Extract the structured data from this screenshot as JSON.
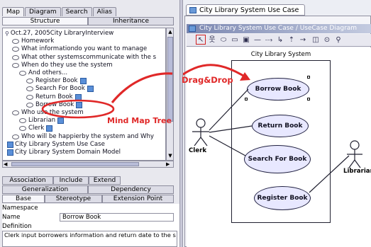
{
  "left_tabs": [
    "Map",
    "Diagram",
    "Search",
    "Alias"
  ],
  "left_subtabs": [
    "Structure",
    "Inheritance"
  ],
  "tree": [
    {
      "text": "Oct.27, 2005City LibraryInterview",
      "indent": 0,
      "type": "root"
    },
    {
      "text": "Homework",
      "indent": 1,
      "type": "node"
    },
    {
      "text": "What informationdo you want to manage",
      "indent": 1,
      "type": "node"
    },
    {
      "text": "What other systemscommunicate with the s",
      "indent": 1,
      "type": "node"
    },
    {
      "text": "When do they use the system",
      "indent": 1,
      "type": "node"
    },
    {
      "text": "And others...",
      "indent": 2,
      "type": "node"
    },
    {
      "text": "Register Book",
      "indent": 3,
      "type": "link"
    },
    {
      "text": "Search For Book",
      "indent": 3,
      "type": "link"
    },
    {
      "text": "Return Book",
      "indent": 3,
      "type": "link"
    },
    {
      "text": "Borrow Book",
      "indent": 3,
      "type": "link"
    },
    {
      "text": "Who use the system",
      "indent": 1,
      "type": "node"
    },
    {
      "text": "Librarian",
      "indent": 2,
      "type": "link"
    },
    {
      "text": "Clerk",
      "indent": 2,
      "type": "link"
    },
    {
      "text": "Who will be happierby the system and Why",
      "indent": 1,
      "type": "node"
    },
    {
      "text": "City Library System Use Case",
      "indent": 0,
      "type": "diagram"
    },
    {
      "text": "City Library System Domain Model",
      "indent": 0,
      "type": "diagram"
    }
  ],
  "prop_tabs_row1": [
    "Association",
    "Include",
    "Extend"
  ],
  "prop_tabs_row2": [
    "Generalization",
    "Dependency"
  ],
  "prop_tabs_row3": [
    "Base",
    "Stereotype",
    "Extension Point"
  ],
  "props": {
    "namespace_label": "Namespace",
    "name_label": "Name",
    "name_value": "Borrow Book",
    "definition_label": "Definition",
    "definition_value": "Clerk input borrowers information and return date to the s"
  },
  "diagram_tab": "City Library System Use Case",
  "diagram_breadcrumb": "City Library System Use Case / UseCase Diagram",
  "system_title": "City Library System",
  "use_cases": [
    "Borrow Book",
    "Return Book",
    "Search For Book",
    "Register Book"
  ],
  "actors": [
    "Clerk",
    "Librarian"
  ],
  "annotations": {
    "mind_map": "Mind Map Tree",
    "drag_drop": "Drag&Drop"
  },
  "colors": {
    "accent": "#e02828",
    "usecase_fill": "#e8e8ff"
  }
}
